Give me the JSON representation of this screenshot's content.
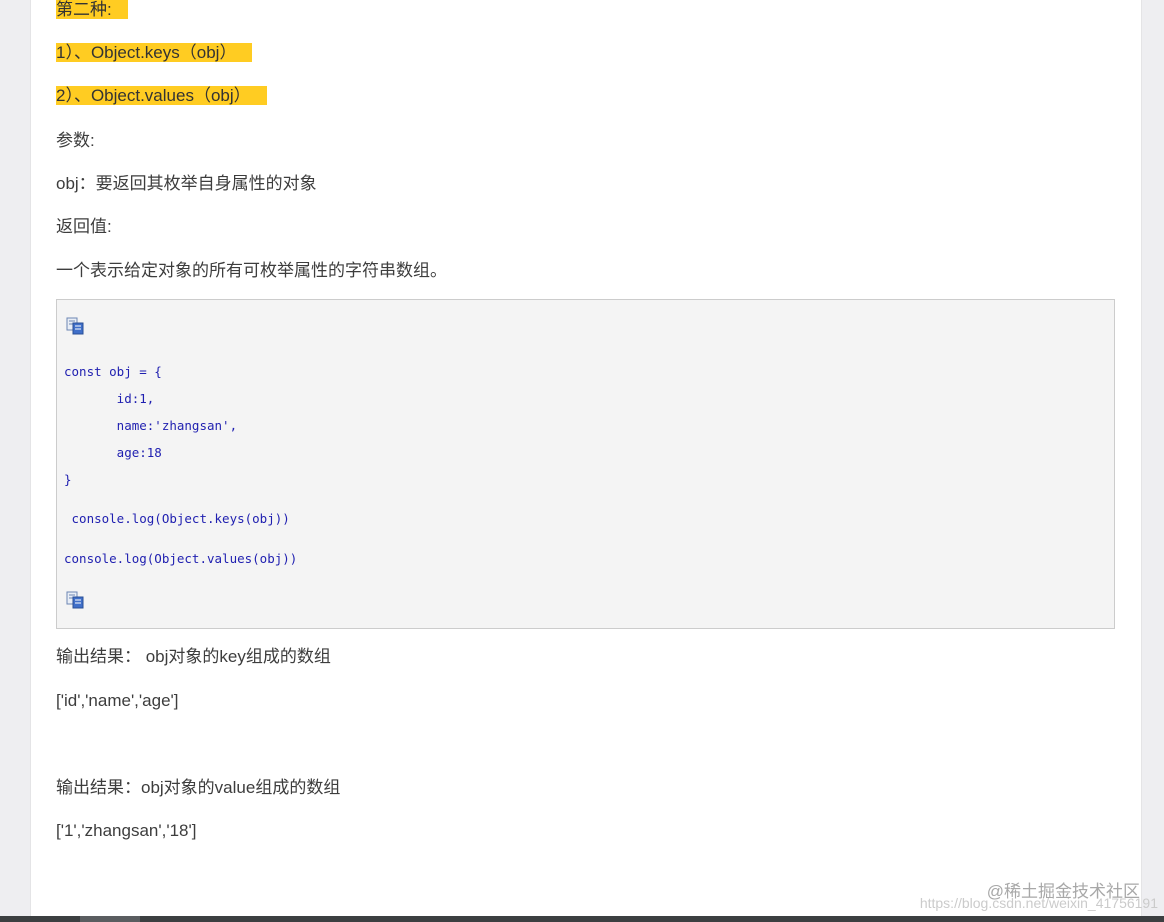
{
  "article": {
    "heading": "第二种:",
    "methods": [
      "1）、Object.keys（obj）",
      "2）、Object.values（obj）"
    ],
    "params_label": "参数:",
    "param_desc": "obj：要返回其枚举自身属性的对象",
    "return_label": "返回值:",
    "return_desc": "一个表示给定对象的所有可枚举属性的字符串数组。",
    "code_lines": [
      "const obj = {",
      "       id:1,",
      "       name:'zhangsan',",
      "       age:18",
      "}",
      " console.log(Object.keys(obj))",
      "console.log(Object.values(obj))"
    ],
    "output_keys_label": "输出结果：  obj对象的key组成的数组",
    "output_keys_value": "['id','name','age']",
    "output_values_label": "输出结果：obj对象的value组成的数组",
    "output_values_value": "['1','zhangsan','18']"
  },
  "icons": {
    "copy": "copy-code-icon"
  },
  "colors": {
    "highlight": "#ffcc22",
    "code_text": "#1f1fb0",
    "code_bg": "#f4f4f4"
  },
  "watermark": {
    "brand": "@稀土掘金技术社区",
    "url": "https://blog.csdn.net/weixin_41756191"
  }
}
